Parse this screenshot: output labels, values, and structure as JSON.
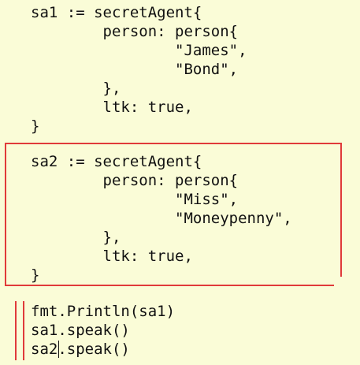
{
  "editor": {
    "block1": {
      "lines": [
        "sa1 := secretAgent{",
        "        person: person{",
        "                \"James\",",
        "                \"Bond\",",
        "        },",
        "        ltk: true,",
        "}"
      ]
    },
    "block2": {
      "lines": [
        "sa2 := secretAgent{",
        "        person: person{",
        "                \"Miss\",",
        "                \"Moneypenny\",",
        "        },",
        "        ltk: true,",
        "}"
      ]
    },
    "block3": {
      "lines": [
        "fmt.Println(sa1)",
        "sa1.speak()",
        "sa2.speak()"
      ]
    }
  },
  "colors": {
    "background": "#fafcd7",
    "text": "#111111",
    "highlight_red": "#e03a3a"
  }
}
